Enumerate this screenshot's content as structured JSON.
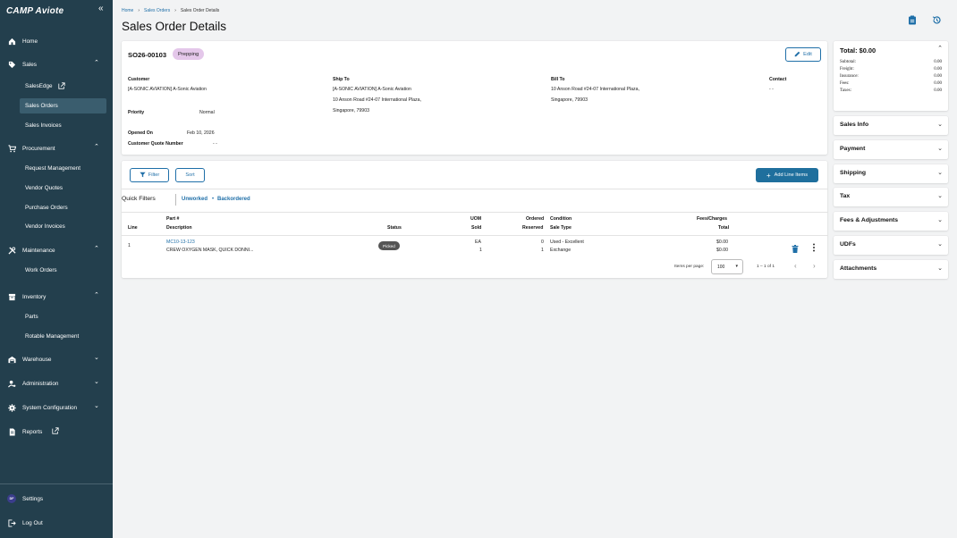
{
  "app": {
    "logo": "CAMP Aviote"
  },
  "sidebar": {
    "items": [
      {
        "label": "Home"
      },
      {
        "label": "Sales"
      },
      {
        "label": "Procurement"
      },
      {
        "label": "Maintenance"
      },
      {
        "label": "Inventory"
      },
      {
        "label": "Warehouse"
      },
      {
        "label": "Administration"
      },
      {
        "label": "System Configuration"
      },
      {
        "label": "Reports"
      }
    ],
    "sales_sub": [
      "SalesEdge",
      "Sales Orders",
      "Sales Invoices"
    ],
    "procurement_sub": [
      "Request Management",
      "Vendor Quotes",
      "Purchase Orders",
      "Vendor Invoices"
    ],
    "maintenance_sub": [
      "Work Orders"
    ],
    "inventory_sub": [
      "Parts",
      "Rotable Management"
    ],
    "settings": {
      "label": "Settings",
      "avatar": "DF"
    },
    "logout": {
      "label": "Log Out"
    }
  },
  "breadcrumb": [
    "Home",
    "Sales Orders",
    "Sales Order Details"
  ],
  "page_title": "Sales Order Details",
  "order": {
    "number": "SO26-00103",
    "status": "Prepping",
    "edit_label": "Edit",
    "customer_label": "Customer",
    "customer_value": "[A-SONIC AVIATION] A-Sonic Aviation",
    "ship_to_label": "Ship To",
    "ship_to_lines": [
      "[A-SONIC AVIATION] A-Sonic Aviation",
      "10 Anson Road #24-07 International Plaza,",
      "Singapore, 79903"
    ],
    "bill_to_label": "Bill To",
    "bill_to_lines": [
      "10 Anson Road #24-07 International Plaza,",
      "Singapore, 79903"
    ],
    "contact_label": "Contact",
    "contact_value": "- -",
    "priority_label": "Priority",
    "priority_value": "Normal",
    "opened_label": "Opened On",
    "opened_value": "Feb 10, 2026",
    "quote_label": "Customer Quote Number",
    "quote_value": "- -"
  },
  "line_items": {
    "filter_label": "Filter",
    "sort_label": "Sort",
    "add_label": "Add Line Items",
    "quick_filters_label": "Quick Filters",
    "quick_filters": [
      "Unworked",
      "Backordered"
    ],
    "quick_filter_separator": "•",
    "headers": {
      "line": "Line",
      "part": "Part #",
      "description": "Description",
      "status": "Status",
      "uom": "UOM",
      "sold": "Sold",
      "ordered": "Ordered",
      "reserved": "Reserved",
      "condition": "Condition",
      "sale_type": "Sale Type",
      "fees": "Fees/Charges",
      "total": "Total"
    },
    "rows": [
      {
        "line": "1",
        "part": "MC10-13-123",
        "description": "CREW OXYGEN MASK, QUICK DONNI...",
        "status": "Picked",
        "uom": "EA",
        "sold": "1",
        "ordered": "0",
        "reserved": "1",
        "condition": "Used - Excellent",
        "sale_type": "Exchange",
        "fees": "$0.00",
        "total": "$0.00"
      }
    ],
    "pager": {
      "items_per_page_label": "Items per page:",
      "items_per_page": "100",
      "range": "1 – 1 of 1"
    }
  },
  "totals": {
    "title": "Total: $0.00",
    "rows": [
      {
        "label": "Subtotal:",
        "value": "0.00"
      },
      {
        "label": "Freight:",
        "value": "0.00"
      },
      {
        "label": "Insurance:",
        "value": "0.00"
      },
      {
        "label": "Fees:",
        "value": "0.00"
      },
      {
        "label": "Taxes:",
        "value": "0.00"
      }
    ]
  },
  "panels": [
    "Sales Info",
    "Payment",
    "Shipping",
    "Tax",
    "Fees & Adjustments",
    "UDFs",
    "Attachments"
  ],
  "colors": {
    "sidebar": "#233f4d",
    "accent": "#1f6fa8",
    "status_chip": "#e4c7ea",
    "primary_button": "#1f6f9d"
  }
}
